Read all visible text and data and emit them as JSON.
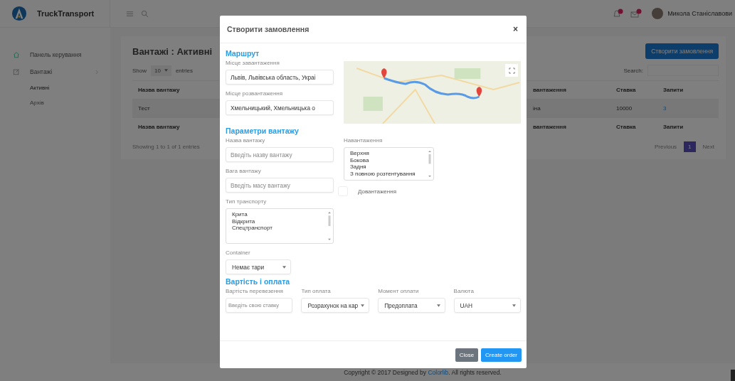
{
  "topbar": {
    "brand": "TruckTransport",
    "user_name": "Микола Станіславови"
  },
  "sidebar": {
    "items": [
      {
        "label": "Панель керування",
        "kind": "home"
      },
      {
        "label": "Вантажі",
        "kind": "edit",
        "children": [
          {
            "label": "Активні",
            "selected": true
          },
          {
            "label": "Архів",
            "selected": false
          }
        ]
      }
    ]
  },
  "page": {
    "title": "Вантажі : Активні",
    "create_button": "Створити замовлення",
    "show_label": "Show",
    "page_size": "10",
    "entries_label": "entries",
    "search_label": "Search:",
    "columns": [
      {
        "label": "Назва вантажу"
      },
      {
        "label": "вантаження"
      },
      {
        "label": "Ставка"
      },
      {
        "label": "Запити"
      }
    ],
    "rows": [
      [
        {
          "text": "Тест",
          "kind": "text"
        },
        {
          "text": "іна",
          "kind": "text"
        },
        {
          "text": "10000",
          "kind": "text"
        },
        {
          "text": "3",
          "kind": "link"
        }
      ]
    ],
    "footer_columns": [
      {
        "label": "Назва вантажу"
      },
      {
        "label": "вантаження"
      },
      {
        "label": "Ставка"
      },
      {
        "label": "Запити"
      }
    ],
    "info": "Showing 1 to 1 of 1 entries",
    "pagination": [
      {
        "label": "Previous",
        "selected": false,
        "disabled": true
      },
      {
        "label": "1",
        "selected": true,
        "disabled": false
      },
      {
        "label": "Next",
        "selected": false,
        "disabled": true
      }
    ]
  },
  "footer": {
    "before": "Copyright © 2017 Designed by ",
    "link": "Colorlib",
    "after": ". All rights reserved."
  },
  "modal": {
    "title": "Створити замовлення",
    "close": "×",
    "route": {
      "heading": "Маршрут",
      "fields": [
        {
          "kind": "input",
          "label": "Місце завантаження",
          "value": "Львів, Львівська область, Украі"
        },
        {
          "kind": "input",
          "label": "Місце розвантаження",
          "value": "Хмельницький, Хмельницька о"
        }
      ]
    },
    "cargo": {
      "heading": "Параметри вантажу",
      "left": [
        {
          "kind": "input",
          "label": "Назва вантажу",
          "placeholder": "Введіть назву вантажу"
        },
        {
          "kind": "input",
          "label": "Вага вантажу",
          "placeholder": "Введіть масу вантажу"
        },
        {
          "kind": "listbox",
          "label": "Тип транспорту",
          "options": [
            "Крита",
            "Відкрита",
            "Спецтранспорт"
          ]
        },
        {
          "kind": "select",
          "label": "Container",
          "value": "Немає тари"
        }
      ],
      "right": [
        {
          "kind": "listbox",
          "label": "Навантаження",
          "options": [
            "Верхня",
            "Бокова",
            "Задня",
            "З повною розтентування"
          ]
        },
        {
          "kind": "checkbox",
          "label": "Довантаження",
          "checked": false
        }
      ]
    },
    "cost": {
      "heading": "Вартість і оплата",
      "fields": [
        {
          "kind": "input",
          "label": "Вартість перевезення",
          "placeholder": "Введіть свою ставку"
        },
        {
          "kind": "select",
          "label": "Тип оплата",
          "value": "Розрахунок на кар"
        },
        {
          "kind": "select",
          "label": "Момент оплати",
          "value": "Предоплата"
        },
        {
          "kind": "select",
          "label": "Валюта",
          "value": "UAH"
        }
      ]
    },
    "buttons": [
      {
        "label": "Close",
        "kind": "secondary"
      },
      {
        "label": "Create order",
        "kind": "primary"
      }
    ]
  }
}
